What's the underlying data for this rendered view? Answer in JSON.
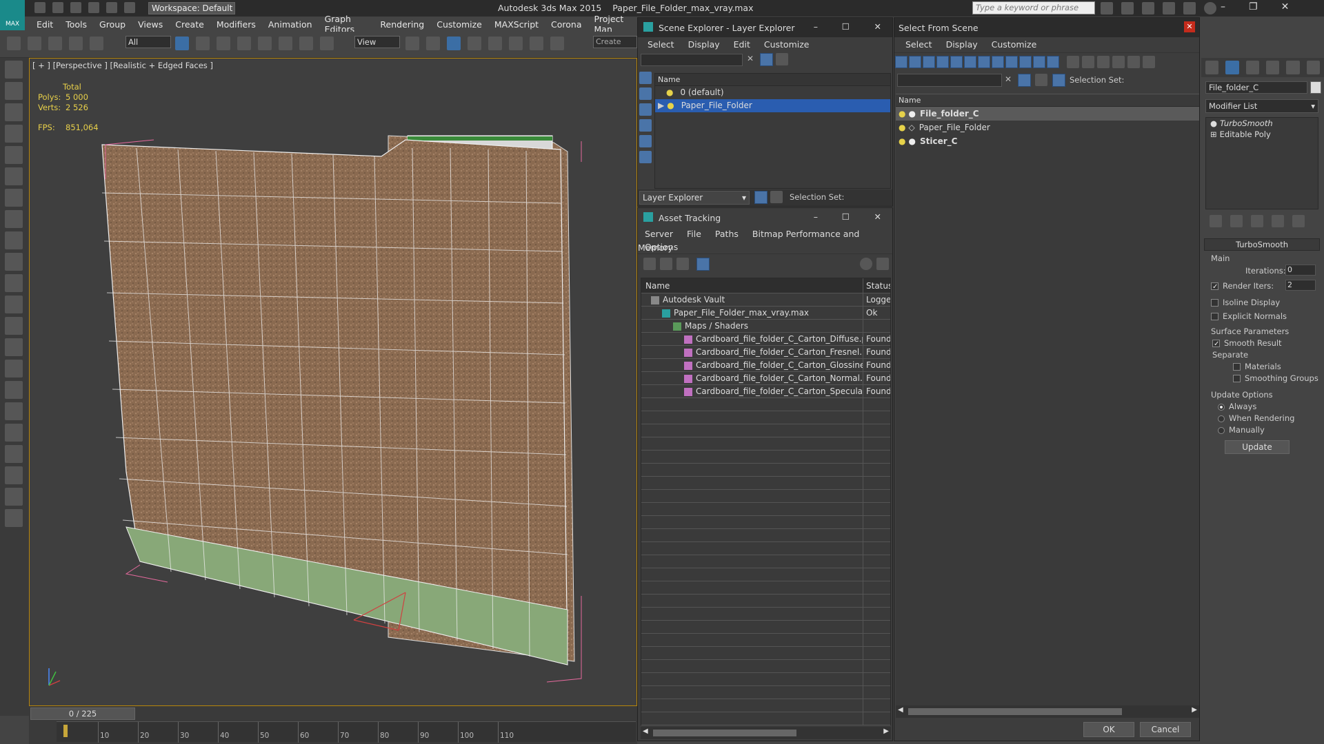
{
  "app": {
    "title": "Autodesk 3ds Max  2015",
    "file": "Paper_File_Folder_max_vray.max",
    "workspace": "Workspace: Default",
    "search_placeholder": "Type a keyword or phrase",
    "logo_text": "MAX"
  },
  "menu": [
    "Edit",
    "Tools",
    "Group",
    "Views",
    "Create",
    "Modifiers",
    "Animation",
    "Graph Editors",
    "Rendering",
    "Customize",
    "MAXScript",
    "Corona",
    "Project Man"
  ],
  "toolbar": {
    "filter": "All",
    "ref_coord": "View",
    "create_sel": "Create Selec"
  },
  "viewport": {
    "label": "[ + ] [Perspective ] [Realistic + Edged Faces ]",
    "stats_title": "Total",
    "polys_label": "Polys:",
    "polys": "5 000",
    "verts_label": "Verts:",
    "verts": "2 526",
    "fps_label": "FPS:",
    "fps": "851,064"
  },
  "timeline": {
    "frame": "0 / 225",
    "ticks": [
      "10",
      "20",
      "30",
      "40",
      "50",
      "60",
      "70",
      "80",
      "90",
      "100",
      "110"
    ]
  },
  "scene_explorer": {
    "title": "Scene Explorer - Layer Explorer",
    "menu": [
      "Select",
      "Display",
      "Edit",
      "Customize"
    ],
    "col_name": "Name",
    "layers": [
      "0 (default)",
      "Paper_File_Folder"
    ],
    "footer_dropdown": "Layer Explorer",
    "selection_set": "Selection Set:"
  },
  "asset_tracking": {
    "title": "Asset Tracking",
    "menu": [
      "Server",
      "File",
      "Paths",
      "Bitmap Performance and Memory"
    ],
    "menu2": "Options",
    "col_name": "Name",
    "col_status": "Status",
    "rows": [
      {
        "name": "Autodesk Vault",
        "status": "Logged",
        "indent": 0
      },
      {
        "name": "Paper_File_Folder_max_vray.max",
        "status": "Ok",
        "indent": 1
      },
      {
        "name": "Maps / Shaders",
        "status": "",
        "indent": 2
      },
      {
        "name": "Cardboard_file_folder_C_Carton_Diffuse.p...",
        "status": "Found",
        "indent": 3
      },
      {
        "name": "Cardboard_file_folder_C_Carton_Fresnel.p...",
        "status": "Found",
        "indent": 3
      },
      {
        "name": "Cardboard_file_folder_C_Carton_Glossines...",
        "status": "Found",
        "indent": 3
      },
      {
        "name": "Cardboard_file_folder_C_Carton_Normal....",
        "status": "Found",
        "indent": 3
      },
      {
        "name": "Cardboard_file_folder_C_Carton_Specular...",
        "status": "Found",
        "indent": 3
      }
    ]
  },
  "select_from_scene": {
    "title": "Select From Scene",
    "menu": [
      "Select",
      "Display",
      "Customize"
    ],
    "selection_set": "Selection Set:",
    "col_name": "Name",
    "items": [
      "File_folder_C",
      "Paper_File_Folder",
      "Sticer_C"
    ],
    "ok": "OK",
    "cancel": "Cancel"
  },
  "command_panel": {
    "object_name": "File_folder_C",
    "modifier_list": "Modifier List",
    "stack": [
      "TurboSmooth",
      "Editable Poly"
    ],
    "rollout": "TurboSmooth",
    "main": "Main",
    "iterations_label": "Iterations:",
    "iterations": "0",
    "render_iters_label": "Render Iters:",
    "render_iters": "2",
    "isoline": "Isoline Display",
    "explicit": "Explicit Normals",
    "surface": "Surface Parameters",
    "smooth": "Smooth Result",
    "separate": "Separate",
    "materials": "Materials",
    "smoothing": "Smoothing Groups",
    "update_opts": "Update Options",
    "always": "Always",
    "when_render": "When Rendering",
    "manually": "Manually",
    "update": "Update"
  },
  "colors": {
    "selection": "#2a5db0",
    "found": "#dddddd",
    "accent": "#b8860b"
  }
}
